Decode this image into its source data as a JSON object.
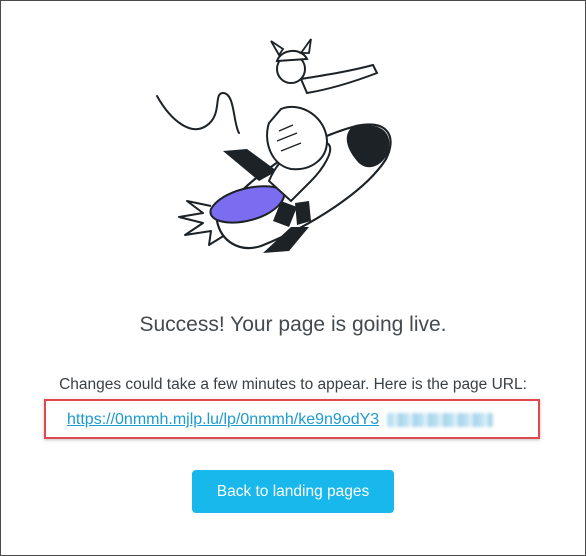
{
  "illustration": {
    "icon": "rocket-rider-illustration",
    "colors": {
      "ink": "#1c2226",
      "accent": "#7c6cf0"
    }
  },
  "success": {
    "title": "Success! Your page is going live.",
    "description": "Changes could take a few minutes to appear. Here is the page URL:",
    "url": "https://0nmmh.mjlp.lu/lp/0nmmh/ke9n9odY3"
  },
  "actions": {
    "back_label": "Back to landing pages"
  },
  "colors": {
    "button": "#18b8ec",
    "link": "#1c9bd0",
    "highlight": "#e0474f",
    "title": "#444a4f"
  }
}
